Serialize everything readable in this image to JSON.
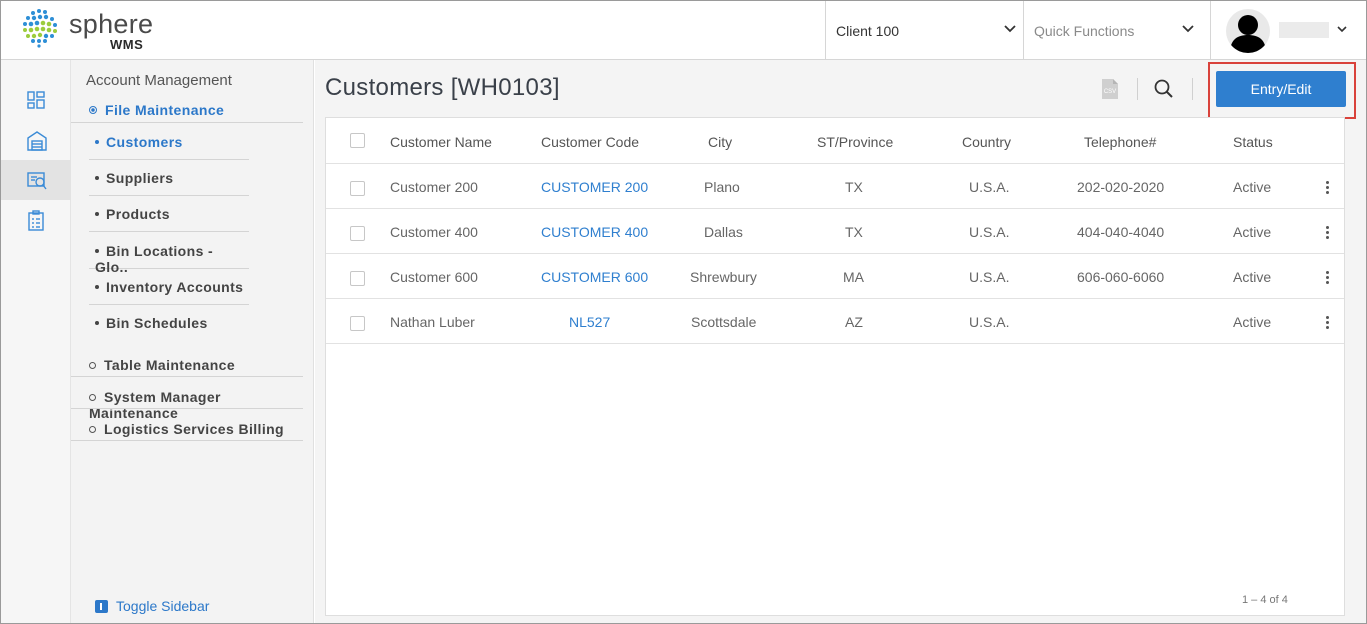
{
  "header": {
    "brand": "sphere",
    "brand_sub": "WMS",
    "client_selector": "Client 100",
    "quick_functions_placeholder": "Quick Functions"
  },
  "nav": {
    "heading": "Account Management",
    "active_section": "File Maintenance",
    "items": [
      {
        "label": "Customers",
        "active": true
      },
      {
        "label": "Suppliers"
      },
      {
        "label": "Products"
      },
      {
        "label": "Bin Locations - Glo.."
      },
      {
        "label": "Inventory Accounts"
      },
      {
        "label": "Bin Schedules"
      }
    ],
    "sections": [
      "Table Maintenance",
      "System Manager Maintenance",
      "Logistics Services Billing"
    ],
    "toggle_label": "Toggle Sidebar"
  },
  "main": {
    "title": "Customers [WH0103]",
    "csv_label": "CSV",
    "entry_button": "Entry/Edit",
    "columns": [
      "Customer Name",
      "Customer Code",
      "City",
      "ST/Province",
      "Country",
      "Telephone#",
      "Status"
    ],
    "rows": [
      {
        "name": "Customer 200",
        "code": "CUSTOMER 200",
        "city": "Plano",
        "state": "TX",
        "country": "U.S.A.",
        "phone": "202-020-2020",
        "status": "Active"
      },
      {
        "name": "Customer 400",
        "code": "CUSTOMER 400",
        "city": "Dallas",
        "state": "TX",
        "country": "U.S.A.",
        "phone": "404-040-4040",
        "status": "Active"
      },
      {
        "name": "Customer 600",
        "code": "CUSTOMER 600",
        "city": "Shrewbury",
        "state": "MA",
        "country": "U.S.A.",
        "phone": "606-060-6060",
        "status": "Active"
      },
      {
        "name": "Nathan Luber",
        "code": "NL527",
        "city": "Scottsdale",
        "state": "AZ",
        "country": "U.S.A.",
        "phone": "",
        "status": "Active"
      }
    ],
    "pagination": "1 – 4 of 4"
  },
  "colors": {
    "accent": "#2f7fcf",
    "highlight": "#d9423b"
  }
}
